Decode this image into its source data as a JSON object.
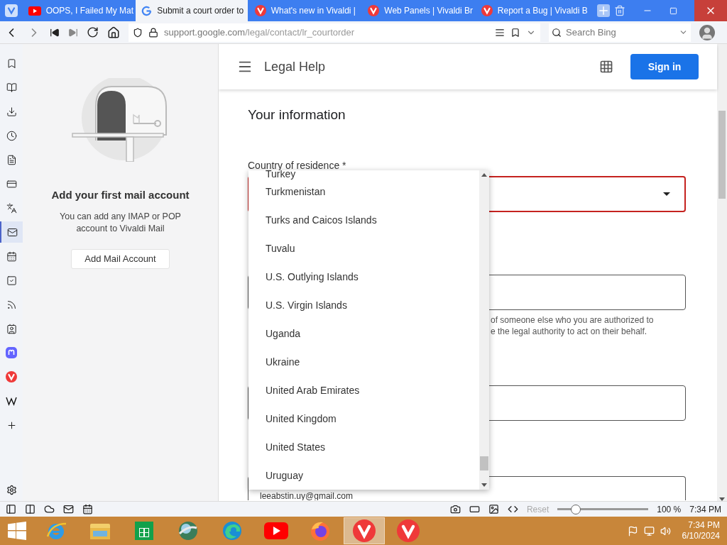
{
  "tabs": [
    {
      "title": "OOPS, I Failed My Mat",
      "kind": "youtube",
      "selected": false
    },
    {
      "title": "Submit a court order to",
      "kind": "google",
      "selected": true
    },
    {
      "title": "What's new in Vivaldi |",
      "kind": "vivaldi",
      "selected": false
    },
    {
      "title": "Web Panels | Vivaldi Br",
      "kind": "vivaldi",
      "selected": false
    },
    {
      "title": "Report a Bug | Vivaldi B",
      "kind": "vivaldi",
      "selected": false
    }
  ],
  "address_bar": {
    "url_host": "support.google.com",
    "url_path": "/legal/contact/lr_courtorder",
    "search_placeholder": "Search Bing"
  },
  "side_panel_icons": [
    {
      "kind": "bookmark",
      "selected": false
    },
    {
      "kind": "reader",
      "selected": false
    },
    {
      "kind": "download",
      "selected": false
    },
    {
      "kind": "history",
      "selected": false
    },
    {
      "kind": "notes",
      "selected": false
    },
    {
      "kind": "window",
      "selected": false
    },
    {
      "kind": "translate",
      "selected": false
    },
    {
      "kind": "mail",
      "selected": true
    },
    {
      "kind": "calendar",
      "selected": false
    },
    {
      "kind": "tasks",
      "selected": false
    },
    {
      "kind": "feed",
      "selected": false
    },
    {
      "kind": "contacts",
      "selected": false
    },
    {
      "kind": "mastodon",
      "selected": false
    },
    {
      "kind": "vivaldi",
      "selected": false
    },
    {
      "kind": "wiki",
      "selected": false
    },
    {
      "kind": "add",
      "selected": false
    }
  ],
  "mail_panel": {
    "heading": "Add your first mail account",
    "text": "You can add any IMAP or POP account to Vivaldi Mail",
    "button": "Add Mail Account"
  },
  "page_header": {
    "title": "Legal Help",
    "sign_in": "Sign in"
  },
  "form": {
    "section_title": "Your information",
    "country_label": "Country of residence *",
    "country_error": true,
    "helper_text": [
      "of someone else who you are authorized to",
      "e the legal authority to act on their behalf."
    ],
    "email_value": "leeabstin.uy@gmail.com"
  },
  "dropdown": {
    "options": [
      {
        "label": "Turkey",
        "selected": false
      },
      {
        "label": "Turkmenistan",
        "selected": false
      },
      {
        "label": "Turks and Caicos Islands",
        "selected": false
      },
      {
        "label": "Tuvalu",
        "selected": false
      },
      {
        "label": "U.S. Outlying Islands",
        "selected": false
      },
      {
        "label": "U.S. Virgin Islands",
        "selected": false
      },
      {
        "label": "Uganda",
        "selected": false
      },
      {
        "label": "Ukraine",
        "selected": false
      },
      {
        "label": "United Arab Emirates",
        "selected": false
      },
      {
        "label": "United Kingdom",
        "selected": false
      },
      {
        "label": "United States",
        "selected": false
      },
      {
        "label": "Uruguay",
        "selected": false
      }
    ]
  },
  "status_bar": {
    "reset": "Reset",
    "zoom": {
      "level": 0.2
    },
    "zoom_text": "100 %",
    "time": "7:34 PM"
  },
  "taskbar": {
    "apps": [
      {
        "kind": "ie",
        "selected": false
      },
      {
        "kind": "folder",
        "selected": false
      },
      {
        "kind": "store",
        "selected": false
      },
      {
        "kind": "globe",
        "selected": false
      },
      {
        "kind": "edge",
        "selected": false
      },
      {
        "kind": "youtube",
        "selected": false
      },
      {
        "kind": "firefox",
        "selected": false
      },
      {
        "kind": "vivaldi",
        "selected": true
      },
      {
        "kind": "vivaldi",
        "selected": false
      }
    ],
    "time": "7:34 PM",
    "date": "6/10/2024"
  }
}
